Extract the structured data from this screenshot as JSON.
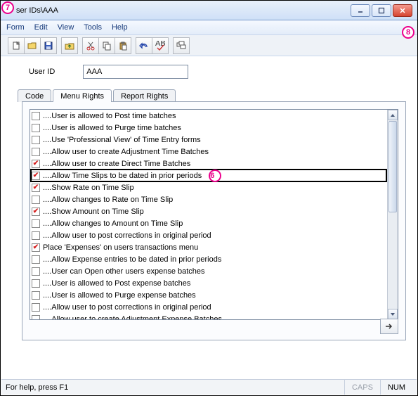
{
  "titlebar": {
    "title": "ser IDs\\AAA"
  },
  "menubar": {
    "items": [
      "Form",
      "Edit",
      "View",
      "Tools",
      "Help"
    ]
  },
  "toolbar": {
    "buttons": [
      "new",
      "open",
      "save",
      "folder-up",
      "cut",
      "copy",
      "paste",
      "undo",
      "spellcheck",
      "cascade"
    ]
  },
  "userid": {
    "label": "User ID",
    "value": "AAA"
  },
  "tabs": {
    "items": [
      "Code",
      "Menu Rights",
      "Report Rights"
    ],
    "active_index": 1
  },
  "list": {
    "items": [
      {
        "checked": false,
        "text": "....User is allowed to Post time batches"
      },
      {
        "checked": false,
        "text": "....User is allowed to Purge time batches"
      },
      {
        "checked": false,
        "text": "....Use 'Professional View' of Time Entry forms"
      },
      {
        "checked": false,
        "text": "....Allow user to create Adjustment Time Batches"
      },
      {
        "checked": true,
        "text": "....Allow user to create Direct Time Batches"
      },
      {
        "checked": true,
        "text": "....Allow Time Slips to be dated in prior periods",
        "selected": true
      },
      {
        "checked": true,
        "text": "....Show Rate on Time Slip"
      },
      {
        "checked": false,
        "text": "....Allow changes to Rate on Time Slip"
      },
      {
        "checked": true,
        "text": "....Show Amount on Time Slip"
      },
      {
        "checked": false,
        "text": "....Allow changes to Amount on Time Slip"
      },
      {
        "checked": false,
        "text": "....Allow user to post corrections in original period"
      },
      {
        "checked": true,
        "text": "Place 'Expenses' on users transactions menu"
      },
      {
        "checked": false,
        "text": "....Allow Expense entries to be dated in prior periods"
      },
      {
        "checked": false,
        "text": "....User can Open other users expense batches"
      },
      {
        "checked": false,
        "text": "....User is allowed to Post expense batches"
      },
      {
        "checked": false,
        "text": "....User is allowed to Purge expense batches"
      },
      {
        "checked": false,
        "text": "....Allow user to post corrections in original period"
      },
      {
        "checked": false,
        "text": "....Allow user to create Adjustment Expense Batches"
      }
    ]
  },
  "statusbar": {
    "hint": "For help, press F1",
    "caps": "CAPS",
    "num": "NUM"
  },
  "callouts": {
    "c6": "6",
    "c7": "7",
    "c8": "8"
  }
}
